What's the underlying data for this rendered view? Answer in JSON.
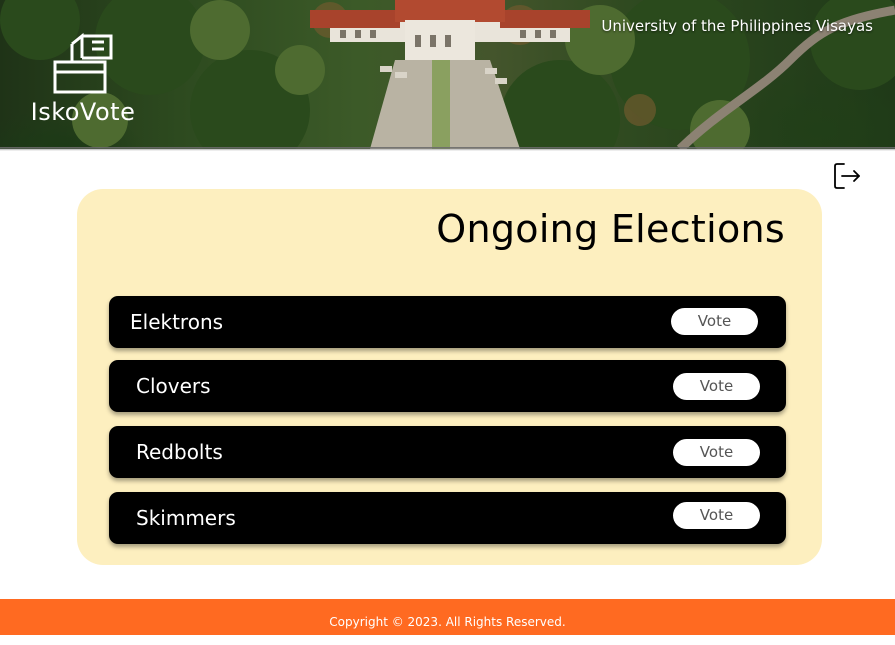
{
  "header": {
    "logo_text": "IskoVote",
    "university": "University of the Philippines Visayas"
  },
  "main": {
    "title": "Ongoing Elections",
    "elections": [
      {
        "name": "Elektrons",
        "action": "Vote"
      },
      {
        "name": "Clovers",
        "action": "Vote"
      },
      {
        "name": "Redbolts",
        "action": "Vote"
      },
      {
        "name": "Skimmers",
        "action": "Vote"
      }
    ]
  },
  "icons": {
    "logo": "ballot-box-icon",
    "logout": "logout-icon"
  },
  "footer": {
    "copyright": "Copyright © 2023. All Rights Reserved."
  },
  "colors": {
    "card_background": "#fdefbf",
    "row_background": "#000000",
    "footer_background": "#ff6a21",
    "button_background": "#ffffff"
  }
}
